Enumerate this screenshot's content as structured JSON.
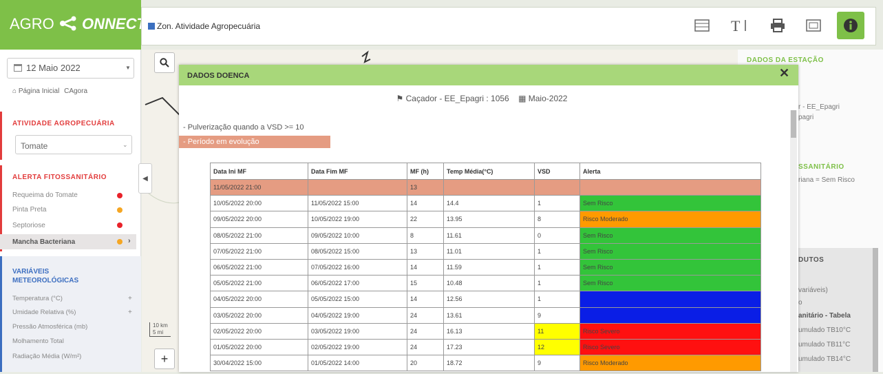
{
  "header": {
    "logo_text_a": "AGRO",
    "logo_text_b": "ONNECT",
    "layer_label": "Zon. Atividade Agropecuária",
    "toolbar_icons": [
      "table-icon",
      "text-size-icon",
      "print-icon",
      "legend-icon",
      "info-icon"
    ]
  },
  "sidebar": {
    "date": "12 Maio 2022",
    "home_link": "Página Inicial",
    "now_link": "Agora",
    "activity_title": "ATIVIDADE AGROPECUÁRIA",
    "crop": "Tomate",
    "alert_title": "ALERTA FITOSSANITÁRIO",
    "alerts": [
      {
        "label": "Requeima do Tomate",
        "color": "#e8222a"
      },
      {
        "label": "Pinta Preta",
        "color": "#f5a623"
      },
      {
        "label": "Septoriose",
        "color": "#e8222a"
      },
      {
        "label": "Mancha Bacteriana",
        "color": "#f5a623"
      }
    ],
    "met_title": "VARIÁVEIS METEOROLÓGICAS",
    "met_items": [
      "Temperatura (°C)",
      "Umidade Relativa (%)",
      "Pressão Atmosférica (mb)",
      "Molhamento Total",
      "Radiação Média (W/m²)"
    ]
  },
  "map": {
    "scale_km": "10 km",
    "scale_mi": "5 mi"
  },
  "right_panel": {
    "station_title": "DADOS DA ESTAÇÃO",
    "station_text": "r - EE_Epagri",
    "station_text2": "pagri",
    "alert_title": "SSANITÁRIO",
    "alert_text": "riana = Sem Risco",
    "products_title": "DUTOS",
    "items": [
      "variáveis)",
      "o",
      "anitário - Tabela",
      "umulado TB10°C",
      "umulado TB11°C",
      "umulado TB14°C"
    ]
  },
  "modal": {
    "title": "DADOS DOENCA",
    "station": "Caçador - EE_Epagri : 1056",
    "period": "Maio-2022",
    "legend_1": "- Pulverização quando a VSD >= 10",
    "legend_2": "- Período em evolução",
    "columns": [
      "Data Ini MF",
      "Data Fim MF",
      "MF (h)",
      "Temp Média(°C)",
      "VSD",
      "Alerta"
    ],
    "rows": [
      {
        "ini": "11/05/2022 21:00",
        "fim": "",
        "mf": "13",
        "temp": "",
        "vsd": "",
        "alerta": "",
        "alert_color": "#e59c82",
        "row_color": "#e59c82",
        "vsd_color": ""
      },
      {
        "ini": "10/05/2022 20:00",
        "fim": "11/05/2022 15:00",
        "mf": "14",
        "temp": "14.4",
        "vsd": "1",
        "alerta": "Sem Risco",
        "alert_color": "#33c43a",
        "row_color": "",
        "vsd_color": ""
      },
      {
        "ini": "09/05/2022 20:00",
        "fim": "10/05/2022 19:00",
        "mf": "22",
        "temp": "13.95",
        "vsd": "8",
        "alerta": "Risco Moderado",
        "alert_color": "#ff9a00",
        "row_color": "",
        "vsd_color": ""
      },
      {
        "ini": "08/05/2022 21:00",
        "fim": "09/05/2022 10:00",
        "mf": "8",
        "temp": "11.61",
        "vsd": "0",
        "alerta": "Sem Risco",
        "alert_color": "#33c43a",
        "row_color": "",
        "vsd_color": ""
      },
      {
        "ini": "07/05/2022 21:00",
        "fim": "08/05/2022 15:00",
        "mf": "13",
        "temp": "11.01",
        "vsd": "1",
        "alerta": "Sem Risco",
        "alert_color": "#33c43a",
        "row_color": "",
        "vsd_color": ""
      },
      {
        "ini": "06/05/2022 21:00",
        "fim": "07/05/2022 16:00",
        "mf": "14",
        "temp": "11.59",
        "vsd": "1",
        "alerta": "Sem Risco",
        "alert_color": "#33c43a",
        "row_color": "",
        "vsd_color": ""
      },
      {
        "ini": "05/05/2022 21:00",
        "fim": "06/05/2022 17:00",
        "mf": "15",
        "temp": "10.48",
        "vsd": "1",
        "alerta": "Sem Risco",
        "alert_color": "#33c43a",
        "row_color": "",
        "vsd_color": ""
      },
      {
        "ini": "04/05/2022 20:00",
        "fim": "05/05/2022 15:00",
        "mf": "14",
        "temp": "12.56",
        "vsd": "1",
        "alerta": "",
        "alert_color": "#0a1ee6",
        "row_color": "",
        "vsd_color": ""
      },
      {
        "ini": "03/05/2022 20:00",
        "fim": "04/05/2022 19:00",
        "mf": "24",
        "temp": "13.61",
        "vsd": "9",
        "alerta": "",
        "alert_color": "#0a1ee6",
        "row_color": "",
        "vsd_color": ""
      },
      {
        "ini": "02/05/2022 20:00",
        "fim": "03/05/2022 19:00",
        "mf": "24",
        "temp": "16.13",
        "vsd": "11",
        "alerta": "Risco Severo",
        "alert_color": "#ff1010",
        "row_color": "",
        "vsd_color": "#ffff00"
      },
      {
        "ini": "01/05/2022 20:00",
        "fim": "02/05/2022 19:00",
        "mf": "24",
        "temp": "17.23",
        "vsd": "12",
        "alerta": "Risco Severo",
        "alert_color": "#ff1010",
        "row_color": "",
        "vsd_color": "#ffff00"
      },
      {
        "ini": "30/04/2022 15:00",
        "fim": "01/05/2022 14:00",
        "mf": "20",
        "temp": "18.72",
        "vsd": "9",
        "alerta": "Risco Moderado",
        "alert_color": "#ff9a00",
        "row_color": "",
        "vsd_color": ""
      }
    ]
  },
  "colors": {
    "brand_green": "#7ec048",
    "modal_header": "#a8d77a",
    "alert_red": "#e23c3c",
    "met_blue": "#3c6ec0"
  }
}
